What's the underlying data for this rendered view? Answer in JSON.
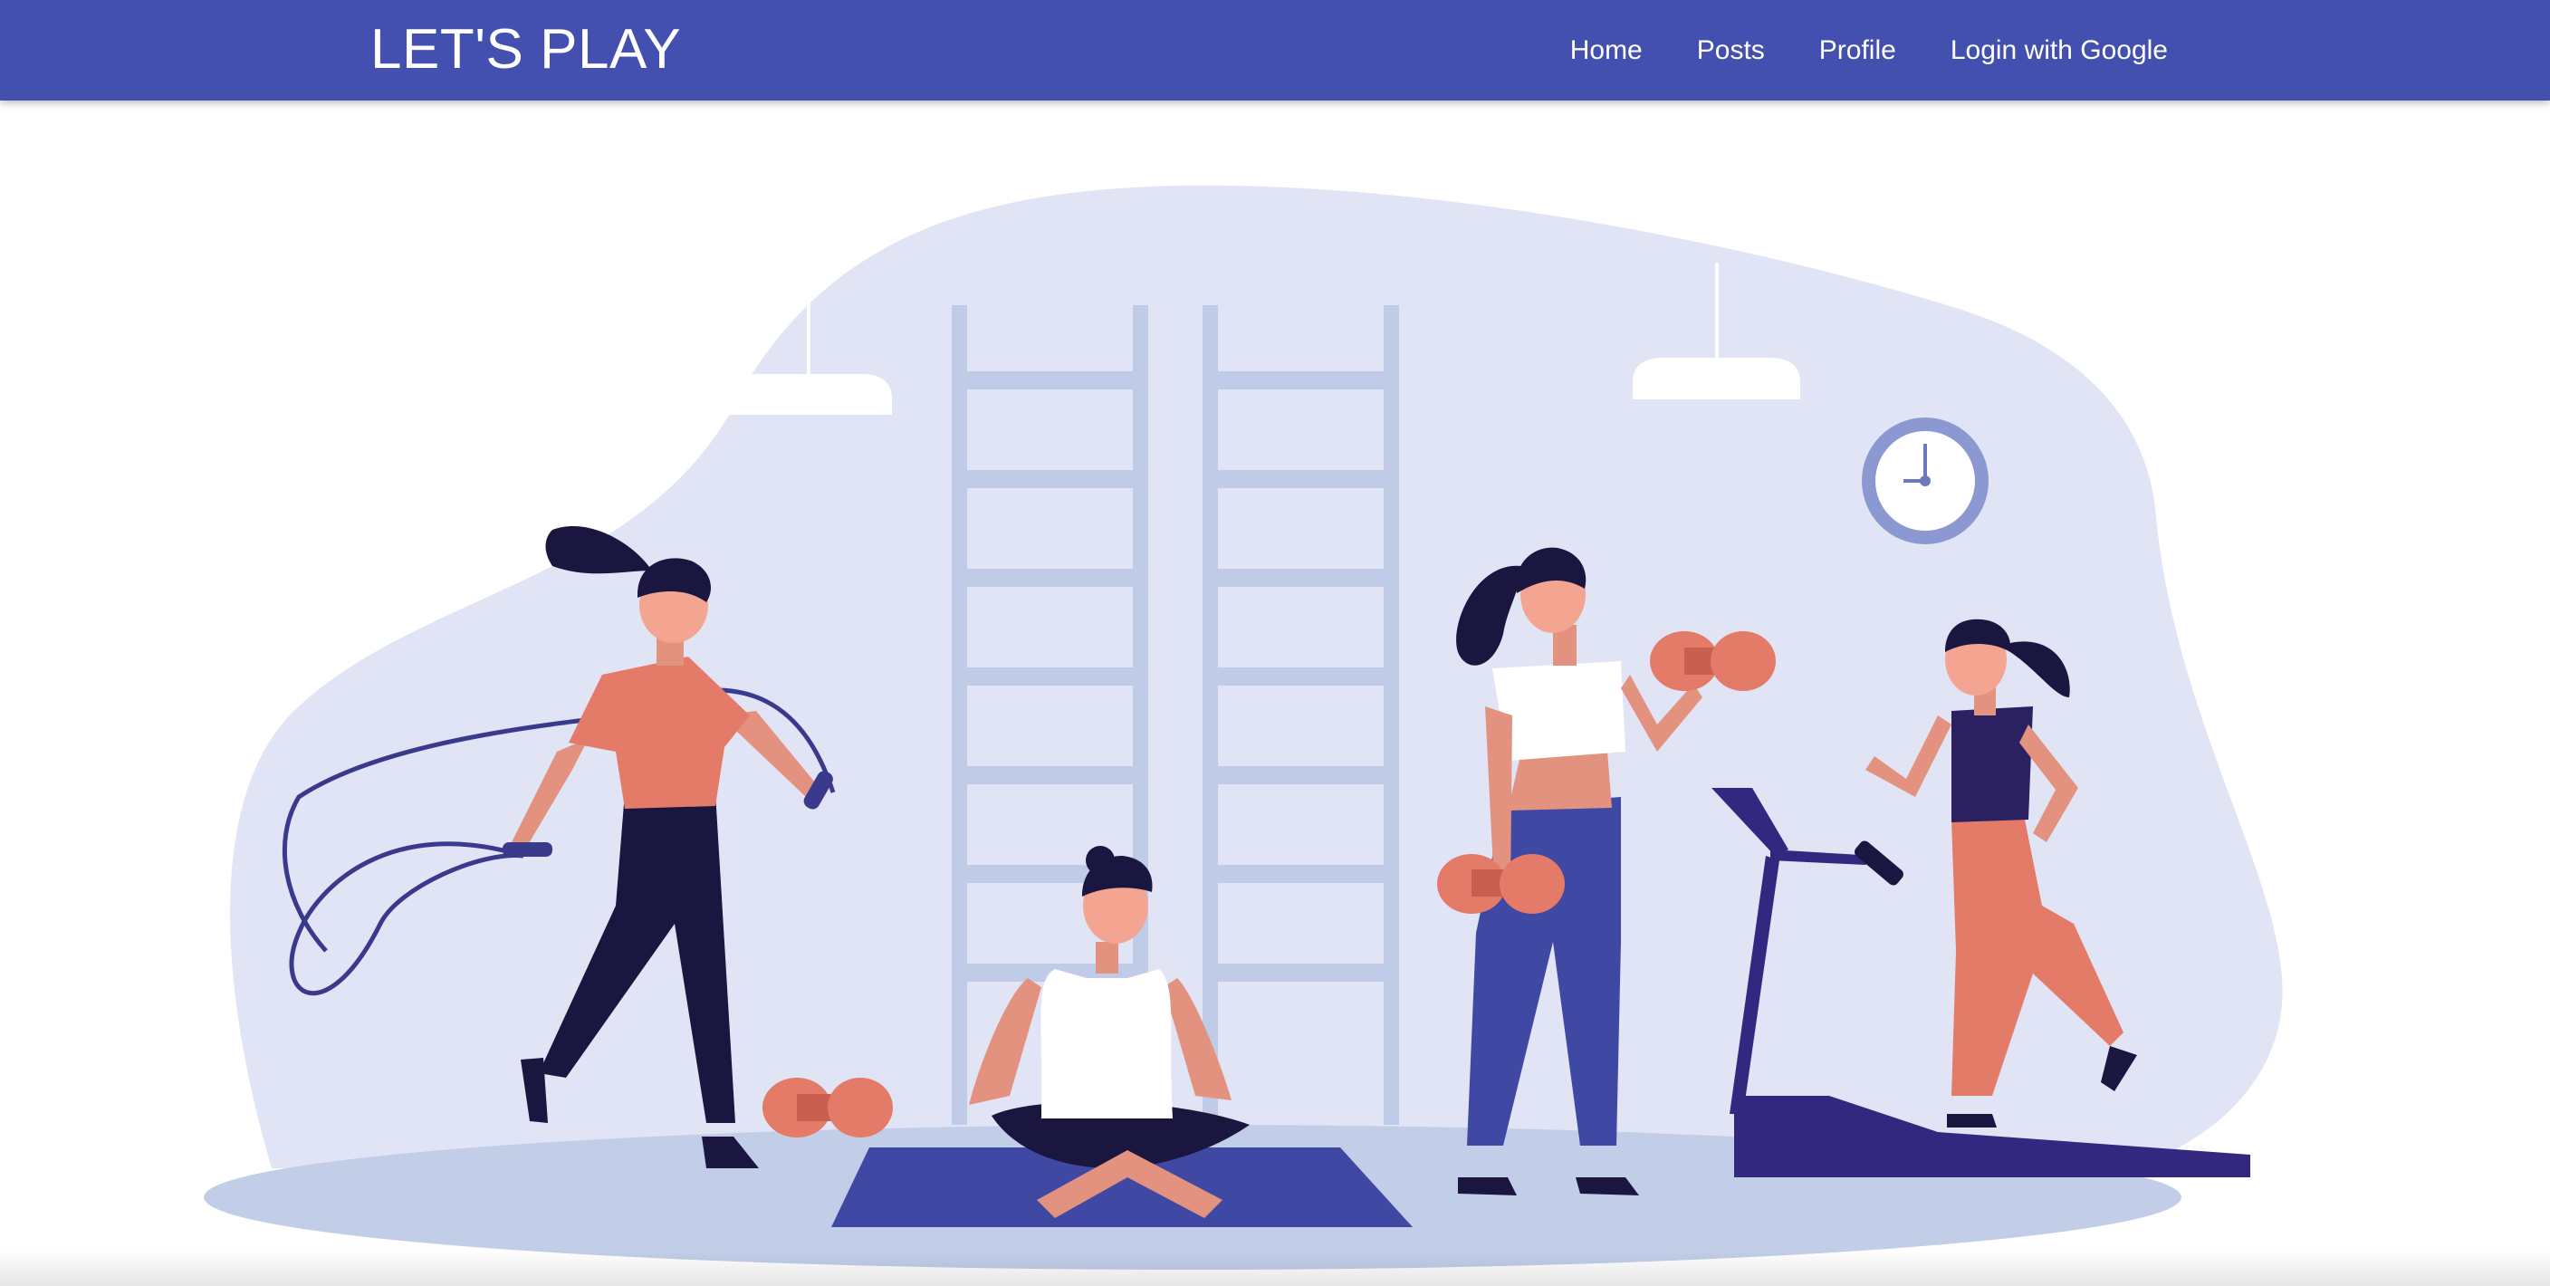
{
  "navbar": {
    "brand": "LET'S PLAY",
    "links": [
      "Home",
      "Posts",
      "Profile",
      "Login with Google"
    ]
  },
  "hero": {
    "illustration": "fitness-gym-illustration"
  },
  "colors": {
    "navbar": "#4450b0",
    "blob": "#e1e4f5",
    "ladder": "#c0cbe8",
    "floor": "#c2cde8",
    "accent_orange": "#e47b68",
    "dark_navy": "#1a1640",
    "mat": "#3f49a3",
    "treadmill": "#332780"
  }
}
